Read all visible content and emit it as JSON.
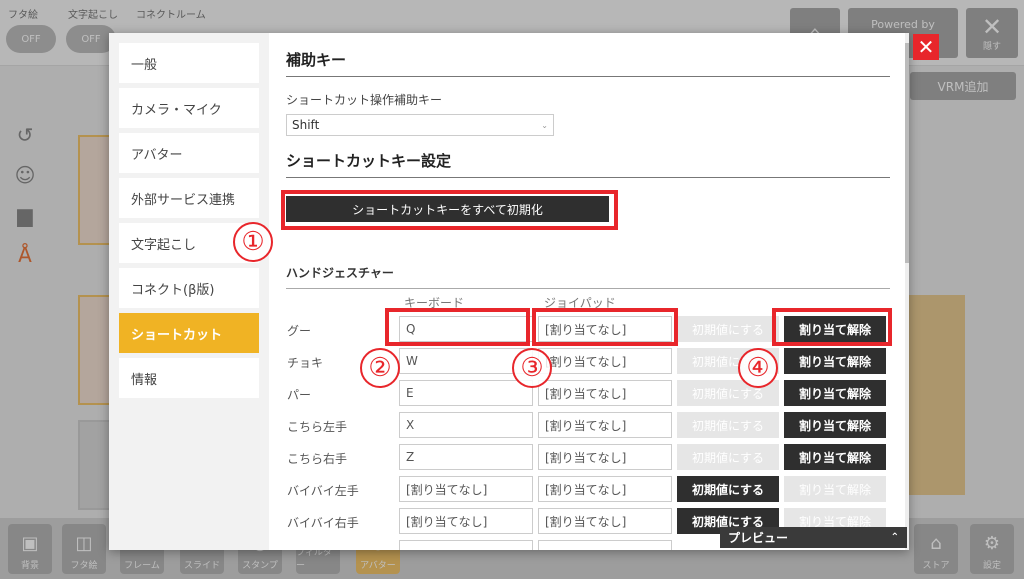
{
  "app": {
    "toggles": [
      {
        "label": "フタ絵",
        "value": "OFF"
      },
      {
        "label": "文字起こし",
        "value": "OFF"
      },
      {
        "label": "コネクトルーム",
        "value": ""
      }
    ],
    "powered_by": "Powered by",
    "hide_label": "隠す",
    "vrm_add": "VRM追加",
    "bottom_tools": [
      "背景",
      "フタ絵",
      "フレーム",
      "スライド",
      "スタンプ",
      "フィルター",
      "アバター",
      "ストア",
      "設定"
    ]
  },
  "settings": {
    "close_icon": "close-icon",
    "sidebar": [
      {
        "label": "一般"
      },
      {
        "label": "カメラ・マイク"
      },
      {
        "label": "アバター"
      },
      {
        "label": "外部サービス連携"
      },
      {
        "label": "文字起こし"
      },
      {
        "label": "コネクト(β版)"
      },
      {
        "label": "ショートカット"
      },
      {
        "label": "情報"
      }
    ],
    "active_index": 6,
    "modifier": {
      "heading": "補助キー",
      "label": "ショートカット操作補助キー",
      "value": "Shift"
    },
    "shortcut": {
      "heading": "ショートカットキー設定",
      "reset_all": "ショートカットキーをすべて初期化"
    },
    "gesture": {
      "heading": "ハンドジェスチャー",
      "col_keyboard": "キーボード",
      "col_joypad": "ジョイパッド",
      "rows": [
        {
          "label": "グー",
          "keyboard": "Q",
          "joypad": "[割り当てなし]",
          "reset": "初期値にする",
          "unassign": "割り当て解除",
          "reset_enabled": false,
          "unassign_enabled": true
        },
        {
          "label": "チョキ",
          "keyboard": "W",
          "joypad": "[割り当てなし]",
          "reset": "初期値にする",
          "unassign": "割り当て解除",
          "reset_enabled": false,
          "unassign_enabled": true
        },
        {
          "label": "パー",
          "keyboard": "E",
          "joypad": "[割り当てなし]",
          "reset": "初期値にする",
          "unassign": "割り当て解除",
          "reset_enabled": false,
          "unassign_enabled": true
        },
        {
          "label": "こちら左手",
          "keyboard": "X",
          "joypad": "[割り当てなし]",
          "reset": "初期値にする",
          "unassign": "割り当て解除",
          "reset_enabled": false,
          "unassign_enabled": true
        },
        {
          "label": "こちら右手",
          "keyboard": "Z",
          "joypad": "[割り当てなし]",
          "reset": "初期値にする",
          "unassign": "割り当て解除",
          "reset_enabled": false,
          "unassign_enabled": true
        },
        {
          "label": "バイバイ左手",
          "keyboard": "[割り当てなし]",
          "joypad": "[割り当てなし]",
          "reset": "初期値にする",
          "unassign": "割り当て解除",
          "reset_enabled": true,
          "unassign_enabled": false
        },
        {
          "label": "バイバイ右手",
          "keyboard": "[割り当てなし]",
          "joypad": "[割り当てなし]",
          "reset": "初期値にする",
          "unassign": "割り当て解除",
          "reset_enabled": true,
          "unassign_enabled": false
        }
      ]
    },
    "preview": {
      "label": "プレビュー",
      "chevron": "chevron-up-icon"
    }
  },
  "annotations": [
    "①",
    "②",
    "③",
    "④"
  ],
  "colors": {
    "accent": "#f0b324",
    "annotation": "#e8262b",
    "dark_button": "#2f2f2f"
  }
}
